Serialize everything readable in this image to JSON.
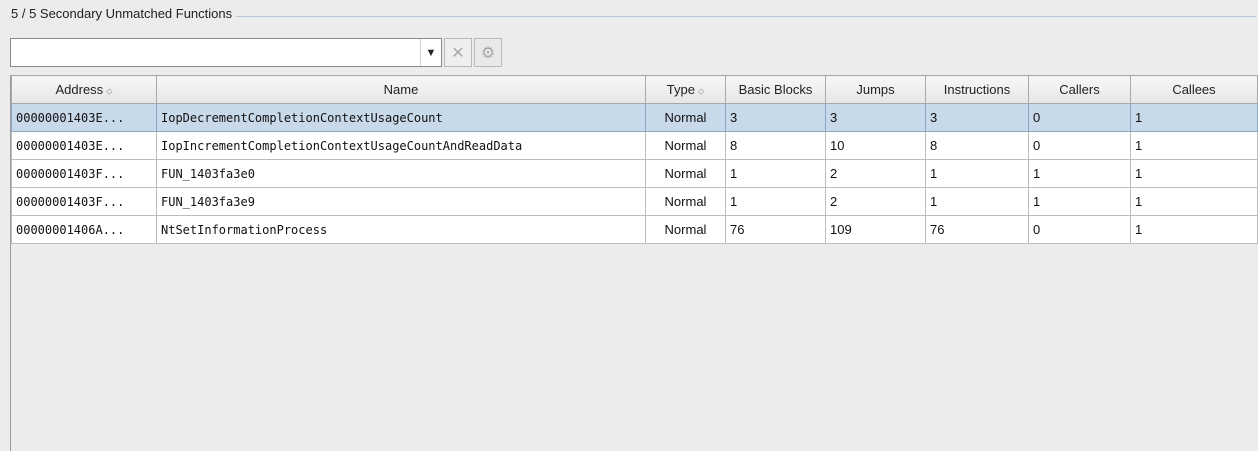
{
  "panel": {
    "title": "5 / 5 Secondary Unmatched Functions"
  },
  "filter": {
    "value": "",
    "placeholder": "",
    "clear_icon": "x-icon",
    "settings_icon": "gear-icon"
  },
  "table": {
    "columns": [
      "Address",
      "Name",
      "Type",
      "Basic Blocks",
      "Jumps",
      "Instructions",
      "Callers",
      "Callees"
    ],
    "sorted_columns": [
      "Address",
      "Type"
    ],
    "rows": [
      {
        "address": "00000001403E...",
        "name": "IopDecrementCompletionContextUsageCount",
        "type": "Normal",
        "basic_blocks": "3",
        "jumps": "3",
        "instructions": "3",
        "callers": "0",
        "callees": "1",
        "selected": true
      },
      {
        "address": "00000001403E...",
        "name": "IopIncrementCompletionContextUsageCountAndReadData",
        "type": "Normal",
        "basic_blocks": "8",
        "jumps": "10",
        "instructions": "8",
        "callers": "0",
        "callees": "1"
      },
      {
        "address": "00000001403F...",
        "name": "FUN_1403fa3e0",
        "type": "Normal",
        "basic_blocks": "1",
        "jumps": "2",
        "instructions": "1",
        "callers": "1",
        "callees": "1"
      },
      {
        "address": "00000001403F...",
        "name": "FUN_1403fa3e9",
        "type": "Normal",
        "basic_blocks": "1",
        "jumps": "2",
        "instructions": "1",
        "callers": "1",
        "callees": "1"
      },
      {
        "address": "00000001406A...",
        "name": "NtSetInformationProcess",
        "type": "Normal",
        "basic_blocks": "76",
        "jumps": "109",
        "instructions": "76",
        "callers": "0",
        "callees": "1"
      }
    ]
  },
  "colors": {
    "selection": "#c8d9ea",
    "background": "#ececec"
  }
}
